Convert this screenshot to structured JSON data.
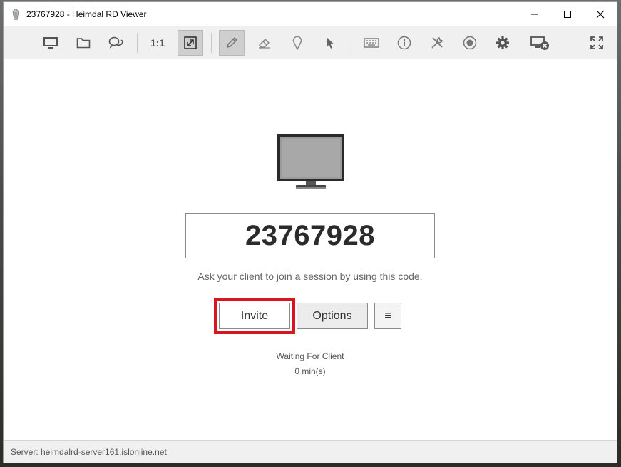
{
  "window": {
    "title": "23767928 - Heimdal RD Viewer"
  },
  "toolbar": {
    "items": [
      {
        "name": "screen-icon"
      },
      {
        "name": "folder-icon"
      },
      {
        "name": "chat-icon"
      },
      {
        "name": "scale-1-1",
        "label": "1:1"
      },
      {
        "name": "fit-icon",
        "active": true
      },
      {
        "name": "pencil-icon",
        "active": true
      },
      {
        "name": "eraser-icon"
      },
      {
        "name": "pin-icon"
      },
      {
        "name": "pointer-icon"
      },
      {
        "name": "keyboard-icon"
      },
      {
        "name": "info-icon"
      },
      {
        "name": "tools-icon"
      },
      {
        "name": "record-icon"
      },
      {
        "name": "gear-icon"
      },
      {
        "name": "disconnect-icon"
      },
      {
        "name": "fullscreen-icon"
      }
    ]
  },
  "session": {
    "code": "23767928",
    "hint": "Ask your client to join a session by using this code.",
    "invite_label": "Invite",
    "options_label": "Options",
    "menu_label": "≡",
    "status": "Waiting For Client",
    "elapsed": "0 min(s)"
  },
  "statusbar": {
    "server": "Server: heimdalrd-server161.islonline.net"
  },
  "colors": {
    "highlight": "#d9161f",
    "toolbar_bg": "#f0f0f0",
    "code_text": "#2b2b2b"
  }
}
